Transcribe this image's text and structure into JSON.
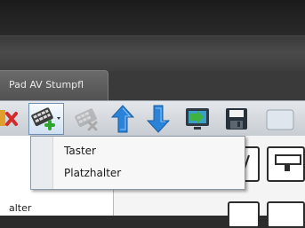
{
  "window": {
    "tab_label": "Pad AV Stumpfl"
  },
  "toolbar": {
    "buttons": [
      {
        "name": "delete-button",
        "icon": "red-x-icon"
      },
      {
        "name": "add-button",
        "icon": "keypad-add-icon",
        "has_dropdown": true
      },
      {
        "name": "remove-button",
        "icon": "keypad-remove-icon",
        "enabled": false
      },
      {
        "name": "move-up-button",
        "icon": "arrow-up-icon"
      },
      {
        "name": "move-down-button",
        "icon": "arrow-down-icon"
      },
      {
        "name": "export-button",
        "icon": "monitor-export-icon"
      },
      {
        "name": "save-button",
        "icon": "floppy-disk-icon"
      }
    ]
  },
  "dropdown_menu": {
    "items": [
      {
        "label": "Taster"
      },
      {
        "label": "Platzhalter"
      }
    ]
  },
  "left_panel": {
    "partial_text": "alter"
  },
  "colors": {
    "accent": "#2b82d9",
    "add_green": "#2ea62e",
    "delete_red": "#d42b2b"
  }
}
